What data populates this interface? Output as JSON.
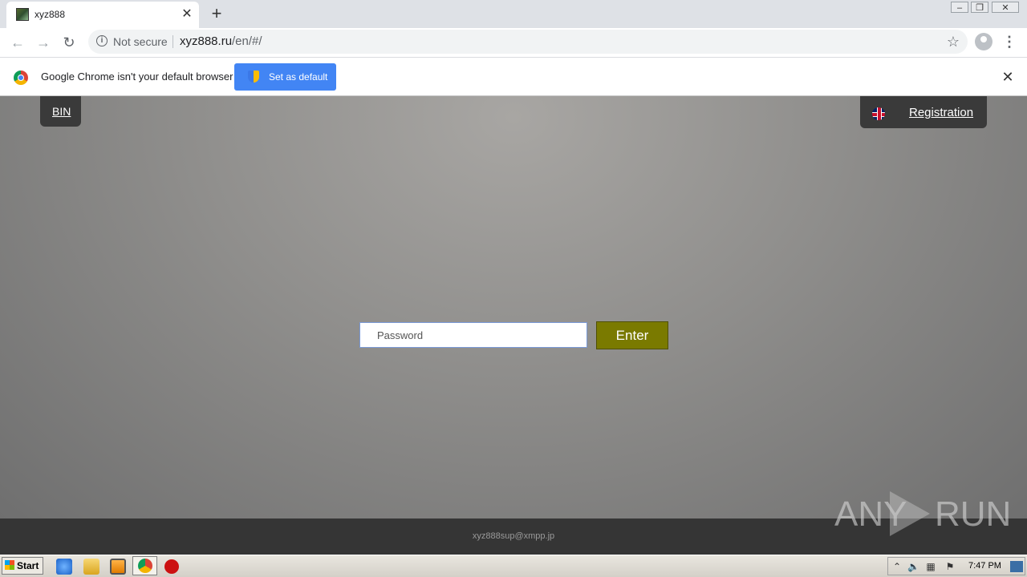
{
  "browser": {
    "tab": {
      "title": "xyz888"
    },
    "address": {
      "security_label": "Not secure",
      "host": "xyz888.ru",
      "path": "/en/#/"
    }
  },
  "infobar": {
    "message": "Google Chrome isn't your default browser",
    "button_label": "Set as default"
  },
  "page": {
    "bin_link": "BIN",
    "registration_link": "Registration",
    "password_placeholder": "Password",
    "enter_button": "Enter",
    "footer_email": "xyz888sup@xmpp.jp",
    "watermark": "ANY RUN"
  },
  "taskbar": {
    "start_label": "Start",
    "clock": "7:47 PM"
  },
  "colors": {
    "enter_button": "#7a7a00",
    "set_default_button": "#4285f4",
    "footer": "#353535"
  }
}
